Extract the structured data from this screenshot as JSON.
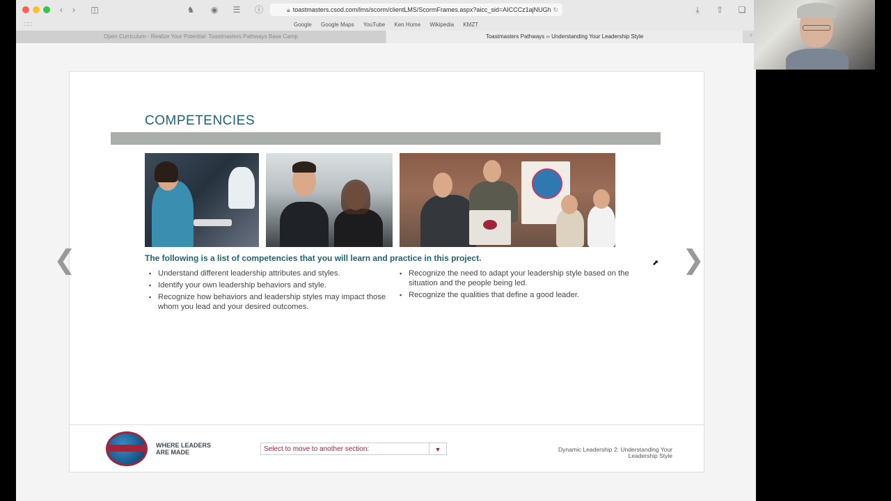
{
  "browser": {
    "url": "toastmasters.csod.com/lms/scorm/clientLMS/ScormFrames.aspx?aicc_sid=AICCCz1ajNUGh",
    "bookmarks": [
      "Google",
      "Google Maps",
      "YouTube",
      "Ken Home",
      "Wikipedia",
      "KMZT"
    ],
    "tabs": [
      {
        "label": "Open Curriculum - Realize Your Potential: Toastmasters Pathways Base Camp",
        "active": false
      },
      {
        "label": "Toastmasters Pathways ›› Understanding Your Leadership Style",
        "active": true
      }
    ]
  },
  "slide": {
    "title": "COMPETENCIES",
    "intro": "The following is a list of competencies that you will learn and practice in this project.",
    "left_items": [
      "Understand different leadership attributes and styles.",
      "Identify your own leadership behaviors and style.",
      "Recognize how behaviors and leadership styles may impact those whom you lead and your desired outcomes."
    ],
    "right_items": [
      "Recognize the need to adapt your leadership style based on the situation and the people being led.",
      "Recognize the qualities that define a good leader."
    ],
    "prev_arrow": "❮",
    "next_arrow": "❯"
  },
  "footer": {
    "tagline_line1": "WHERE LEADERS",
    "tagline_line2": "ARE MADE",
    "section_select_placeholder": "Select to move to another section:",
    "course_line1": "Dynamic Leadership 2: Understanding Your",
    "course_line2": "Leadership Style"
  },
  "colors": {
    "accent_teal": "#1e6470",
    "brand_maroon": "#a2243a",
    "band_gray": "#aaaeab"
  }
}
